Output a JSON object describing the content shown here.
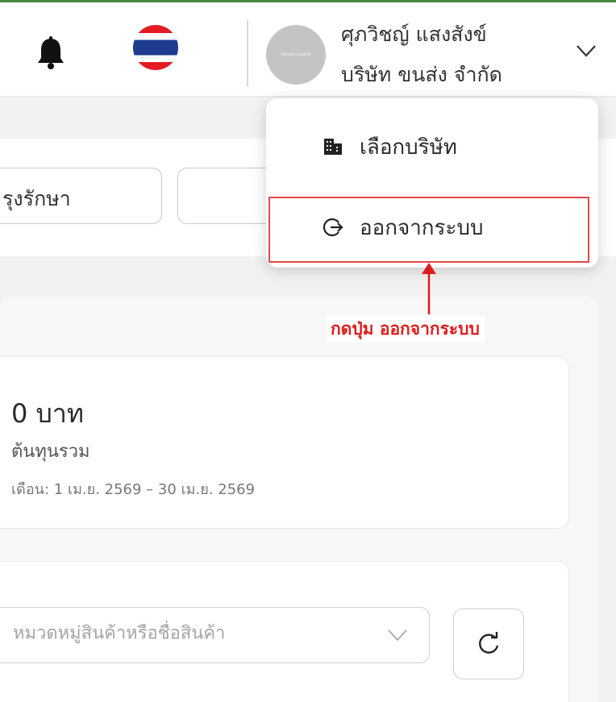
{
  "header": {
    "user_name": "ศุภวิชญ์ แสงสังข์",
    "company_name": "บริษัท ขนส่ง จำกัด",
    "avatar_text": "ศุภวิชญ์ แสงสังข์",
    "flag": "thailand-flag",
    "accent_color": "#4a8a3e"
  },
  "dropdown": {
    "items": [
      {
        "label": "เลือกบริษัท",
        "icon": "building-icon"
      },
      {
        "label": "ออกจากระบบ",
        "icon": "logout-icon"
      }
    ]
  },
  "annotation": {
    "text": "กดปุ่ม ออกจากระบบ",
    "color": "#e01b1b"
  },
  "filters": {
    "branch_value": "รุงรักษา",
    "second_value": ""
  },
  "summary": {
    "amount": "0 บาท",
    "label": "ต้นทุนรวม",
    "period": "เดือน: 1 เม.ย. 2569 – 30 เม.ย. 2569"
  },
  "search": {
    "placeholder": "หมวดหมู่สินค้าหรือชื่อสินค้า"
  }
}
